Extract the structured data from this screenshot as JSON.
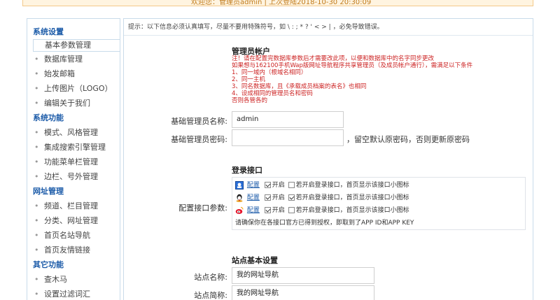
{
  "topbar": {
    "text": "欢迎您：管理员admin | 上次登陆2018-10-30 20:30:09"
  },
  "sidebar": {
    "groups": [
      {
        "title": "系统设置",
        "items": [
          "基本参数管理",
          "数据库管理",
          "始发邮箱",
          "上传图片（LOGO）",
          "编辑关于我们"
        ]
      },
      {
        "title": "系统功能",
        "items": [
          "模式、风格管理",
          "集成搜索引擎管理",
          "功能菜单栏管理",
          "边栏、号外管理"
        ]
      },
      {
        "title": "网址管理",
        "items": [
          "频道、栏目管理",
          "分类、网址管理",
          "首页名站导航",
          "首页友情链接"
        ]
      },
      {
        "title": "其它功能",
        "items": [
          "查木马",
          "设置过滤词汇"
        ]
      }
    ],
    "bullet": "•"
  },
  "main": {
    "tip": "提示：以下信息必须认真填写，尽量不要用特殊符号，如 \\ : ; * ? ' < > | ，必免导致错误。",
    "admin_section": {
      "title": "管理员帐户",
      "notes": [
        "注！请在配置完数据库参数后才需要改此项，以便和数据库中的名字同步更改",
        "如果想与162100手机Wap版网址导航程序共享管理员（及成员帐户通行），需满足以下条件",
        "  1、同一域内（根域名相同）",
        "  2、同一主机",
        "  3、同名数据库，且《承载成员档案的表名》也相同",
        "  4、设成相同的管理员名和密码",
        "否则各管各的"
      ],
      "username_label": "基础管理员名称:",
      "username_value": "admin",
      "password_label": "基础管理员密码:",
      "password_value": "",
      "password_hint": "，留空默认原密码，否则更新原密码"
    },
    "login_section": {
      "title": "登录接口",
      "label": "配置接口参数:",
      "rows": [
        {
          "icon": "qq-icon",
          "link": "配置",
          "enable_label": "开启",
          "enabled": true,
          "show_desc": "若开启登录接口，首页显示该接口小图标",
          "show_icon": false
        },
        {
          "icon": "baidu-icon",
          "link": "配置",
          "enable_label": "开启",
          "enabled": true,
          "show_desc": "若开启登录接口，首页显示该接口小图标",
          "show_icon": true
        },
        {
          "icon": "weibo-icon",
          "link": "配置",
          "enable_label": "开启",
          "enabled": true,
          "show_desc": "若开启登录接口，首页显示该接口小图标",
          "show_icon": false
        }
      ],
      "footer": "请确保你在各接口官方已得到授权，即取到了APP ID和APP KEY"
    },
    "site_section": {
      "title": "站点基本设置",
      "name_label": "站点名称:",
      "name_value": "我的网址导航",
      "short_label": "站点简称:",
      "short_value": "我的网址导航"
    }
  },
  "colors": {
    "accent": "#1a5aa8",
    "warning": "#cc2222",
    "border": "#c9dbea"
  }
}
